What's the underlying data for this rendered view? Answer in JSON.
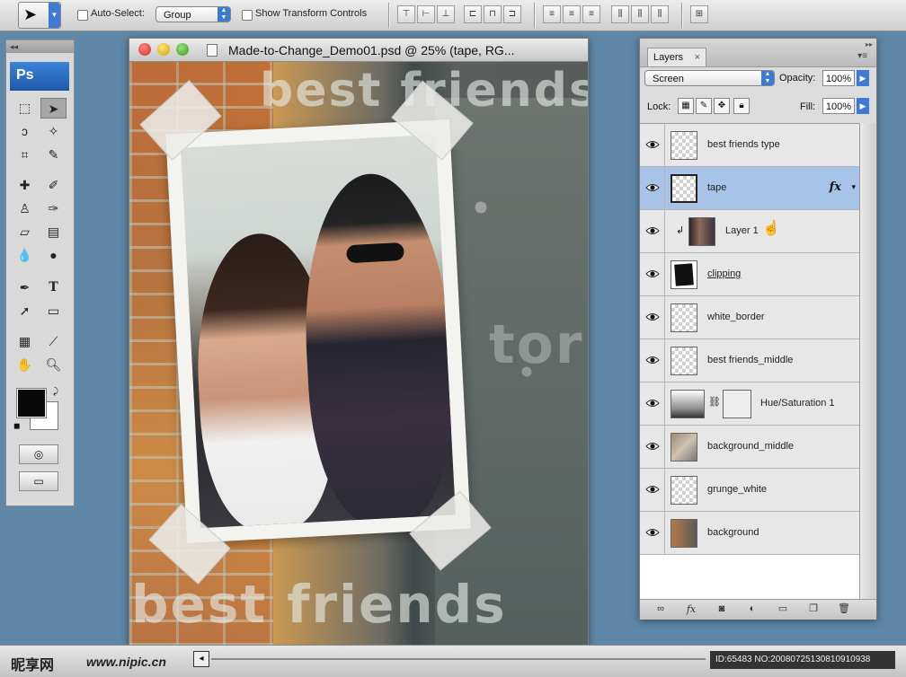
{
  "options_bar": {
    "auto_select_label": "Auto-Select:",
    "auto_select_value": "Group",
    "show_transform_label": "Show Transform Controls"
  },
  "toolbox": {
    "collapse_glyph": "◂◂",
    "logo": "Ps"
  },
  "document": {
    "title": "Made-to-Change_Demo01.psd @ 25% (tape, RG...",
    "canvas_words": [
      "best friends",
      "best friends"
    ],
    "ghost_word": "tor"
  },
  "layers_panel": {
    "tab_label": "Layers",
    "tab_close": "×",
    "blend_mode": "Screen",
    "opacity_label": "Opacity:",
    "opacity_value": "100%",
    "lock_label": "Lock:",
    "fill_label": "Fill:",
    "fill_value": "100%",
    "layers": [
      {
        "name": "best friends type"
      },
      {
        "name": "tape",
        "fx": "fx",
        "selected": true
      },
      {
        "name": "Layer 1"
      },
      {
        "name": "clipping"
      },
      {
        "name": "white_border"
      },
      {
        "name": "best friends_middle"
      },
      {
        "name": "Hue/Saturation 1"
      },
      {
        "name": "background_middle"
      },
      {
        "name": "grunge_white"
      },
      {
        "name": "background"
      }
    ]
  },
  "bottom": {
    "watermark_logo": "昵享网",
    "watermark_url": "www.nipic.cn",
    "image_id": "ID:65483 NO:20080725130810910938"
  },
  "colors": {
    "selection": "#a7c4e8",
    "accent": "#3c7ad6",
    "desktop": "#5f87a7"
  }
}
